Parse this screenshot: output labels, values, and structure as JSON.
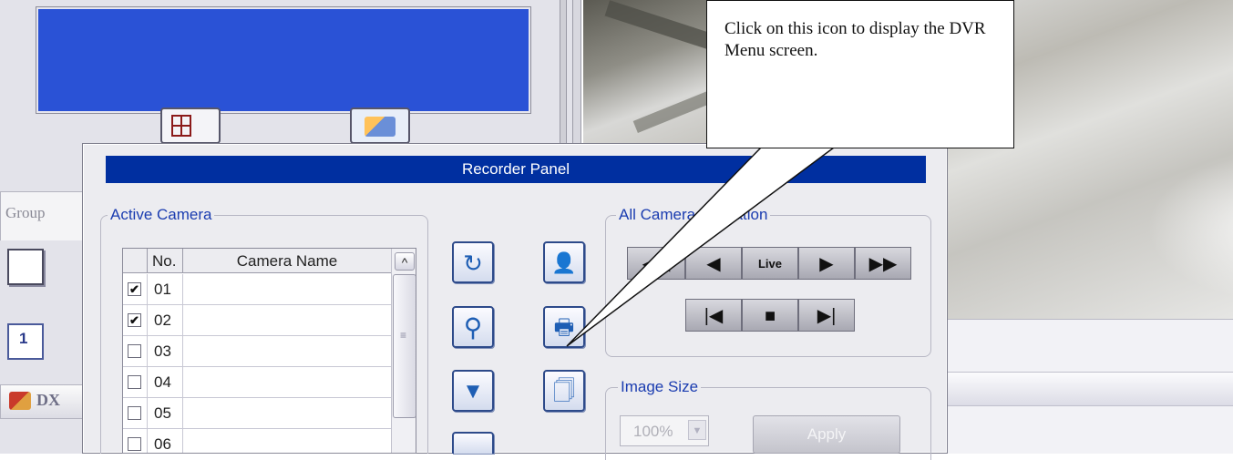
{
  "app": {
    "group_tab_label": "Group",
    "dx_tab_label": "DX",
    "view_one_label": "1"
  },
  "recorder_panel": {
    "title": "Recorder Panel",
    "active_camera": {
      "title": "Active Camera",
      "columns": [
        "No.",
        "Camera Name"
      ],
      "rows": [
        {
          "no": "01",
          "name": "",
          "checked": true
        },
        {
          "no": "02",
          "name": "",
          "checked": true
        },
        {
          "no": "03",
          "name": "",
          "checked": false
        },
        {
          "no": "04",
          "name": "",
          "checked": false
        },
        {
          "no": "05",
          "name": "",
          "checked": false
        },
        {
          "no": "06",
          "name": "",
          "checked": false
        }
      ]
    },
    "tool_buttons": [
      "refresh-icon",
      "user-info-icon",
      "search-icon",
      "dvr-menu-icon",
      "download-icon",
      "document-copy-icon"
    ],
    "all_camera_operation": {
      "title": "All Camera Operation",
      "live_label": "Live"
    },
    "image_size": {
      "title": "Image Size",
      "selected": "100%",
      "apply_label": "Apply"
    }
  },
  "callout": {
    "text": "Click on this icon to display the DVR Menu screen."
  },
  "colors": {
    "title_bar": "#002fa0",
    "group_title": "#1a3cb0",
    "preview_blue": "#2a52d6"
  }
}
